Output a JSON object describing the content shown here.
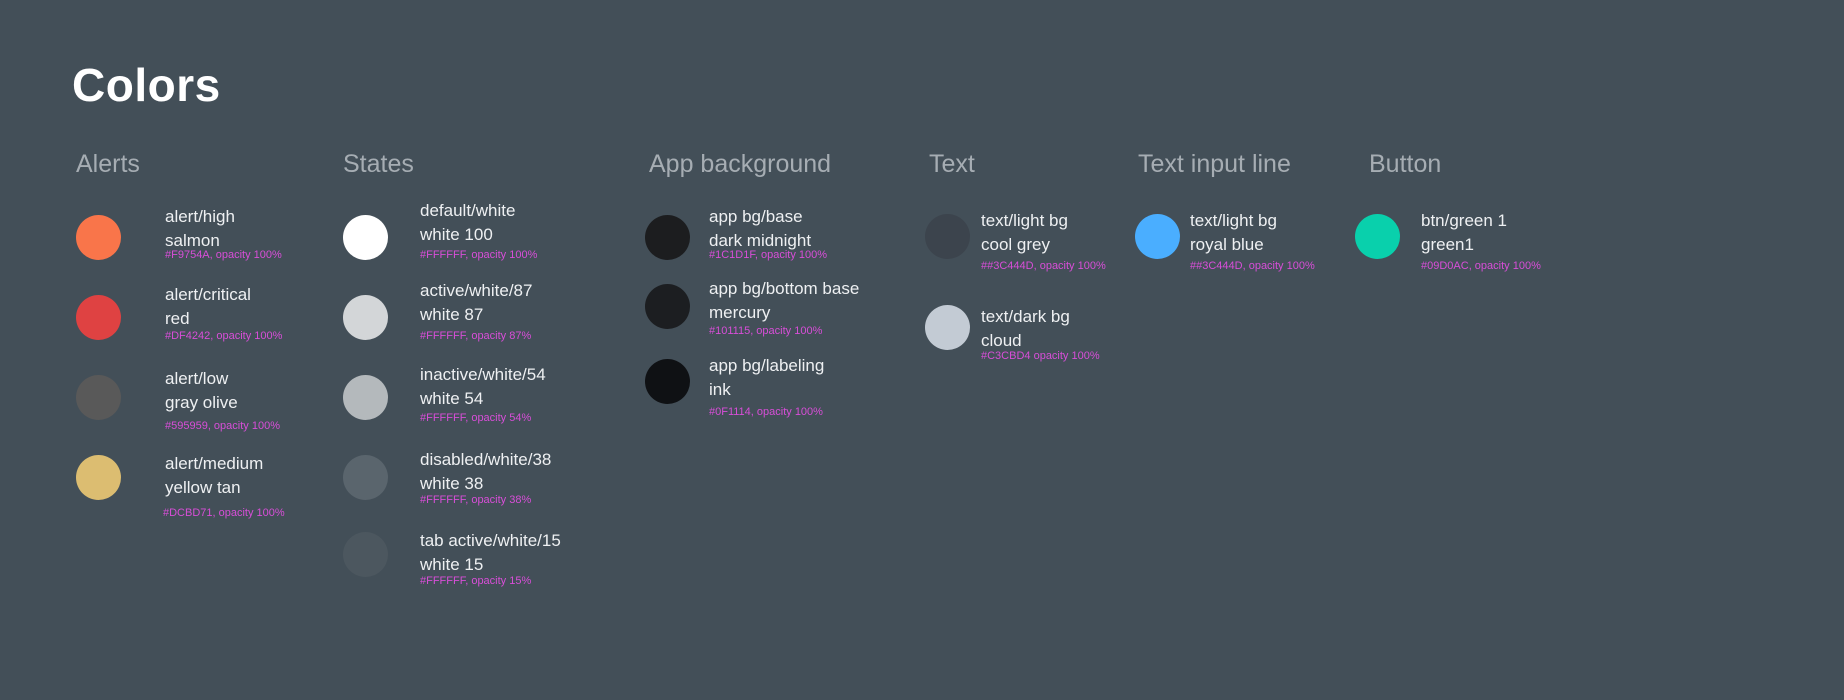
{
  "page": {
    "title": "Colors"
  },
  "groups": [
    {
      "heading": "Alerts",
      "items": [
        {
          "line1": "alert/high",
          "line2": "salmon",
          "meta": "#F9754A, opacity 100%",
          "color": "#F9754A"
        },
        {
          "line1": "alert/critical",
          "line2": "red",
          "meta": "#DF4242, opacity 100%",
          "color": "#DF4242"
        },
        {
          "line1": "alert/low",
          "line2": "gray olive",
          "meta": "#595959, opacity 100%",
          "color": "#595959"
        },
        {
          "line1": "alert/medium",
          "line2": "yellow tan",
          "meta": "#DCBD71, opacity 100%",
          "color": "#DCBD71"
        }
      ]
    },
    {
      "heading": "States",
      "items": [
        {
          "line1": "default/white",
          "line2": "white 100",
          "meta": "#FFFFFF, opacity 100%",
          "color": "#FFFFFF"
        },
        {
          "line1": "active/white/87",
          "line2": "white 87",
          "meta": "#FFFFFF, opacity 87%",
          "color": "#D3D6D8"
        },
        {
          "line1": "inactive/white/54",
          "line2": "white 54",
          "meta": "#FFFFFF, opacity 54%",
          "color": "#B4B9BC"
        },
        {
          "line1": "disabled/white/38",
          "line2": "white 38",
          "meta": "#FFFFFF, opacity 38%",
          "color": "#5A656D"
        },
        {
          "line1": "tab active/white/15",
          "line2": "white 15",
          "meta": "#FFFFFF, opacity 15%",
          "color": "#4C575F"
        }
      ]
    },
    {
      "heading": "App background",
      "items": [
        {
          "line1": "app bg/base",
          "line2": "dark midnight",
          "meta": "#1C1D1F, opacity 100%",
          "color": "#1C1D1F"
        },
        {
          "line1": "app bg/bottom base",
          "line2": "mercury",
          "meta": "#101115, opacity 100%",
          "color": "#1C1E21"
        },
        {
          "line1": "app bg/labeling",
          "line2": "ink",
          "meta": "#0F1114, opacity 100%",
          "color": "#0F1114"
        }
      ]
    },
    {
      "heading": "Text",
      "items": [
        {
          "line1": "text/light bg",
          "line2": "cool grey",
          "meta": "##3C444D, opacity 100%",
          "color": "#3C444D"
        },
        {
          "line1": "text/dark bg",
          "line2": "cloud",
          "meta": "#C3CBD4 opacity 100%",
          "color": "#C3CBD4"
        }
      ]
    },
    {
      "heading": "Text input line",
      "items": [
        {
          "line1": "text/light bg",
          "line2": "royal blue",
          "meta": "##3C444D, opacity 100%",
          "color": "#4AAEFF"
        }
      ]
    },
    {
      "heading": "Button",
      "items": [
        {
          "line1": "btn/green 1",
          "line2": "green1",
          "meta": "#09D0AC, opacity 100%",
          "color": "#09D0AC"
        }
      ]
    }
  ]
}
